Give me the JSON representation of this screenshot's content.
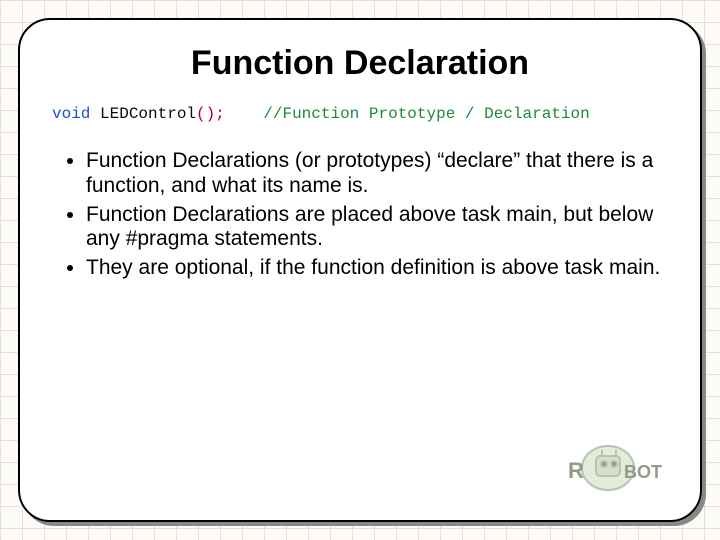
{
  "title": "Function Declaration",
  "code": {
    "keyword": "void",
    "fname": "LEDControl",
    "parens": "();",
    "comment": "//Function Prototype / Declaration"
  },
  "bullets": [
    "Function Declarations (or prototypes) “declare” that there is a function, and what its name is.",
    "Function Declarations are placed above task main, but below any #pragma statements.",
    "They are optional, if the function definition is above task main."
  ],
  "logo": {
    "text_left": "R",
    "text_right": "BOT"
  }
}
